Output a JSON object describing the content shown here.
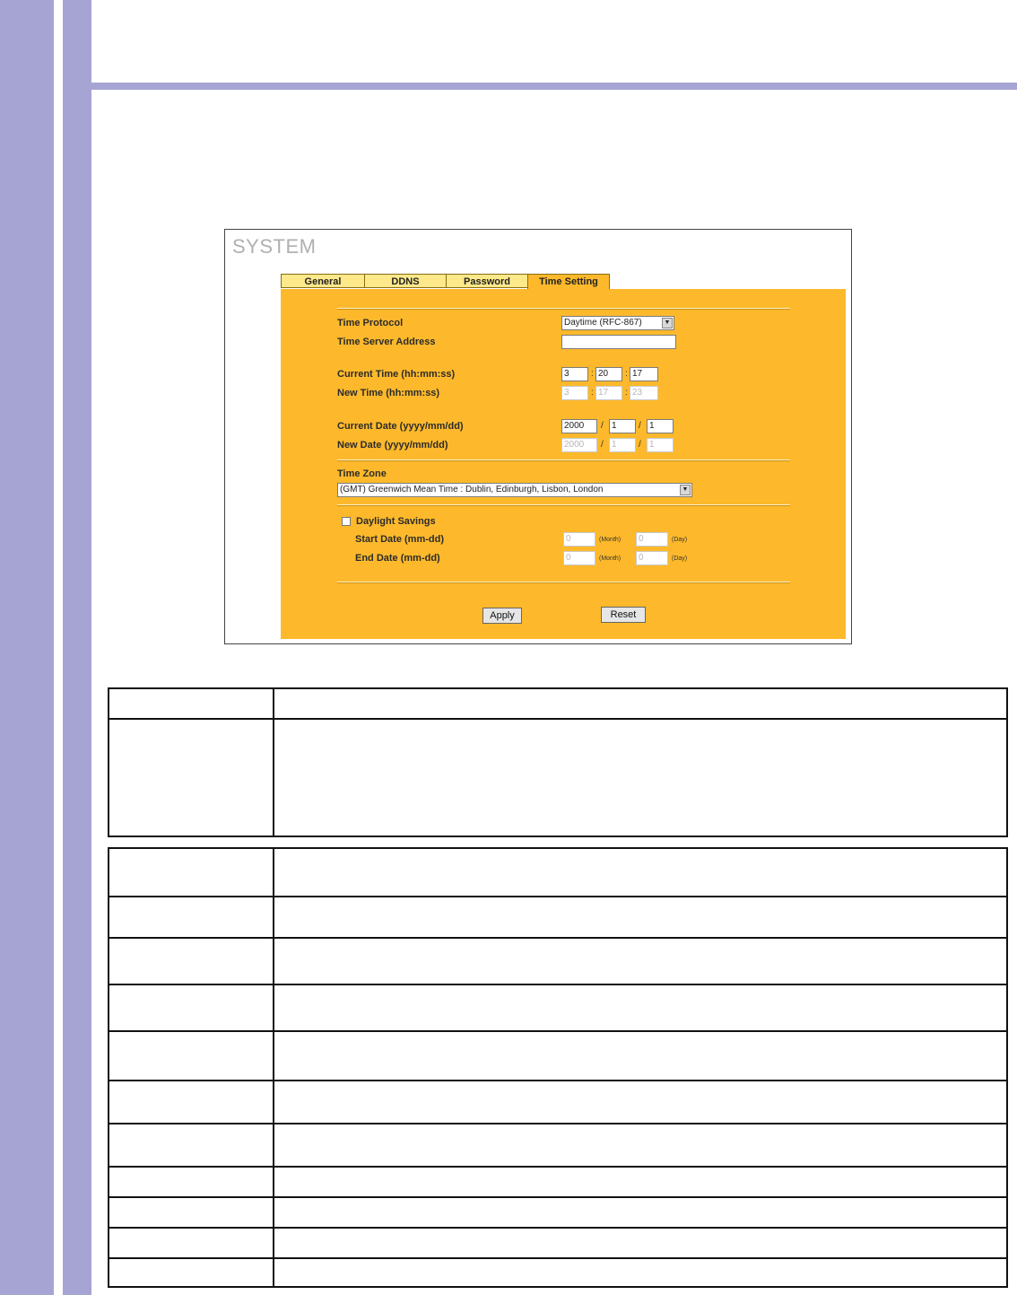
{
  "screen": {
    "title": "SYSTEM",
    "tabs": [
      "General",
      "DDNS",
      "Password",
      "Time Setting"
    ],
    "active_tab": "Time Setting",
    "time_protocol": {
      "label": "Time Protocol",
      "value": "Daytime (RFC-867)"
    },
    "time_server": {
      "label": "Time Server Address",
      "value": ""
    },
    "current_time": {
      "label": "Current Time (hh:mm:ss)",
      "hh": "3",
      "mm": "20",
      "ss": "17"
    },
    "new_time": {
      "label": "New Time (hh:mm:ss)",
      "hh": "3",
      "mm": "17",
      "ss": "23"
    },
    "current_date": {
      "label": "Current Date (yyyy/mm/dd)",
      "yyyy": "2000",
      "mm": "1",
      "dd": "1"
    },
    "new_date": {
      "label": "New Date (yyyy/mm/dd)",
      "yyyy": "2000",
      "mm": "1",
      "dd": "1"
    },
    "time_zone": {
      "label": "Time Zone",
      "value": "(GMT) Greenwich Mean Time : Dublin, Edinburgh, Lisbon, London"
    },
    "daylight": {
      "label": "Daylight Savings",
      "start_label": "Start Date (mm-dd)",
      "end_label": "End Date (mm-dd)",
      "start_month": "0",
      "start_day": "0",
      "end_month": "0",
      "end_day": "0",
      "month_unit": "(Month)",
      "day_unit": "(Day)"
    },
    "buttons": {
      "apply": "Apply",
      "reset": "Reset"
    }
  }
}
